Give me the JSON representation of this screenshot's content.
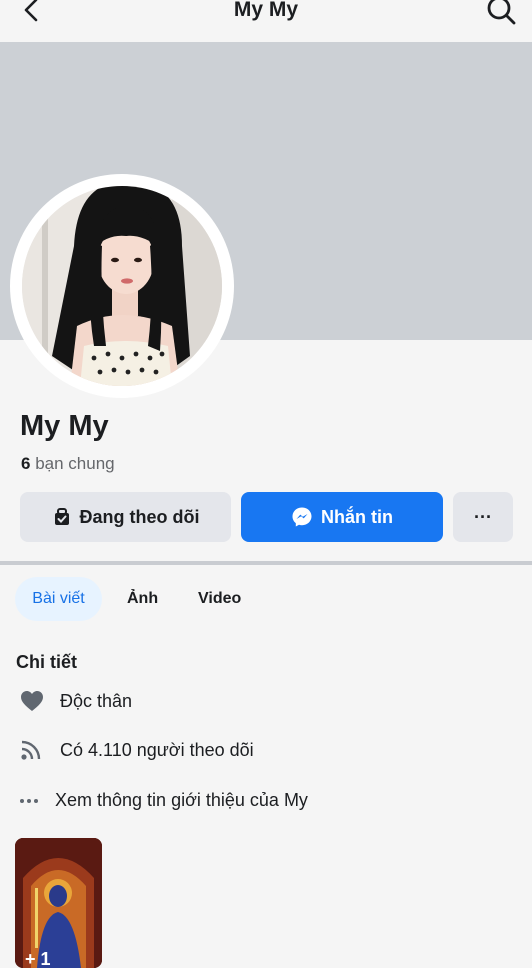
{
  "header": {
    "title": "My My",
    "back_icon": "chevron-left-icon",
    "search_icon": "search-icon"
  },
  "profile": {
    "name": "My My",
    "mutual_count": "6",
    "mutual_label": "bạn chung"
  },
  "actions": {
    "follow_label": "Đang theo dõi",
    "message_label": "Nhắn tin",
    "more_label": "···"
  },
  "tabs": [
    {
      "label": "Bài viết",
      "active": true
    },
    {
      "label": "Ảnh",
      "active": false
    },
    {
      "label": "Video",
      "active": false
    }
  ],
  "details": {
    "title": "Chi tiết",
    "relationship": "Độc thân",
    "followers": "Có 4.110 người theo dõi",
    "about_link": "Xem thông tin giới thiệu của My"
  },
  "photos": {
    "count_label": "+ 1"
  },
  "colors": {
    "accent": "#1877f2",
    "cover": "#ccd0d5",
    "button_gray": "#e4e6eb",
    "tab_active_bg": "#e7f3ff"
  }
}
